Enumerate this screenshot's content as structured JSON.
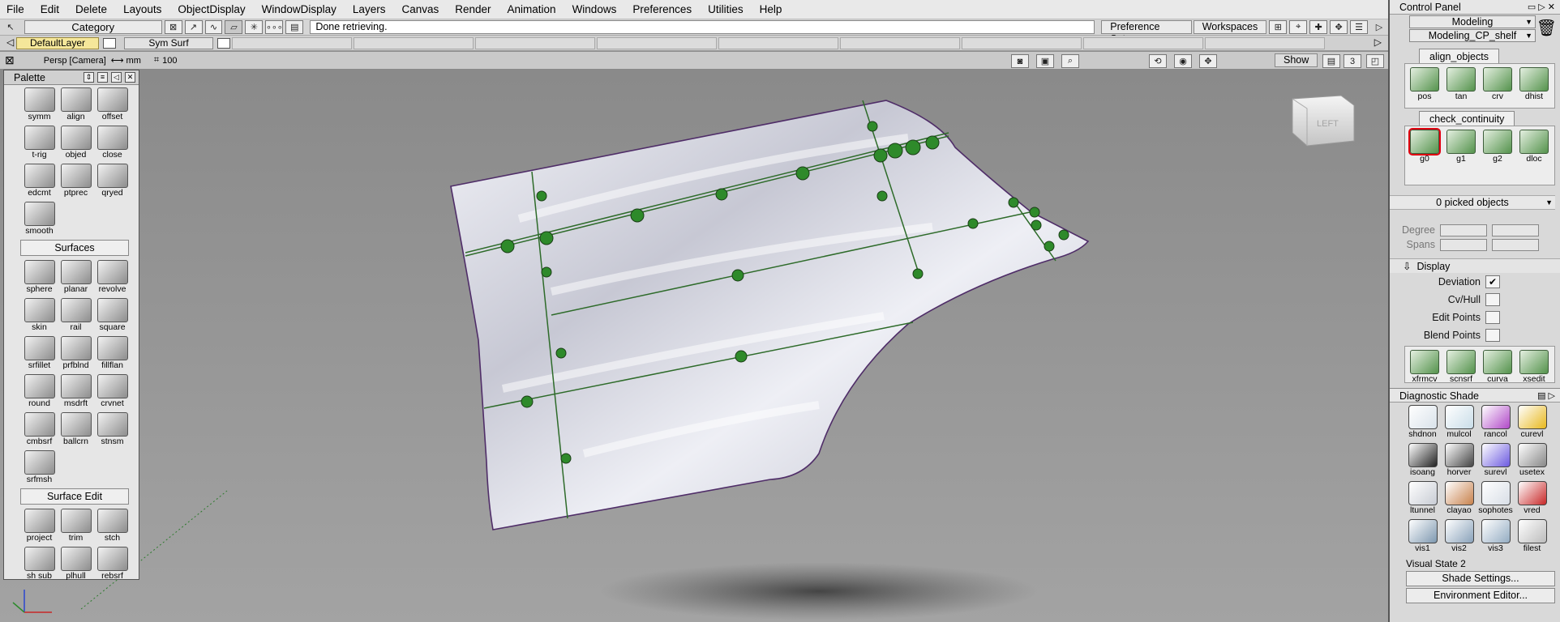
{
  "menu": [
    "File",
    "Edit",
    "Delete",
    "Layouts",
    "ObjectDisplay",
    "WindowDisplay",
    "Layers",
    "Canvas",
    "Render",
    "Animation",
    "Windows",
    "Preferences",
    "Utilities",
    "Help"
  ],
  "toolbar": {
    "category_label": "Category",
    "status_text": "Done retrieving.",
    "preference_sets": "Preference Sets",
    "workspaces": "Workspaces"
  },
  "layers": {
    "default": "DefaultLayer",
    "sym": "Sym Surf"
  },
  "viewbar": {
    "camera": "Persp [Camera]",
    "units": "mm",
    "grid": "100",
    "show_button": "Show",
    "count": "3"
  },
  "viewcube": {
    "face": "LEFT"
  },
  "palette": {
    "title": "Palette",
    "group1": [
      {
        "label": "symm"
      },
      {
        "label": "align"
      },
      {
        "label": "offset"
      },
      {
        "label": "t-rig"
      },
      {
        "label": "objed"
      },
      {
        "label": "close"
      },
      {
        "label": "edcmt"
      },
      {
        "label": "ptprec"
      },
      {
        "label": "qryed"
      },
      {
        "label": "smooth"
      }
    ],
    "surfaces_title": "Surfaces",
    "surfaces": [
      {
        "label": "sphere"
      },
      {
        "label": "planar"
      },
      {
        "label": "revolve"
      },
      {
        "label": "skin"
      },
      {
        "label": "rail"
      },
      {
        "label": "square"
      },
      {
        "label": "srfillet"
      },
      {
        "label": "prfblnd"
      },
      {
        "label": "fillflan"
      },
      {
        "label": "round"
      },
      {
        "label": "msdrft"
      },
      {
        "label": "crvnet"
      },
      {
        "label": "cmbsrf"
      },
      {
        "label": "ballcrn"
      },
      {
        "label": "stnsm"
      },
      {
        "label": "srfmsh"
      }
    ],
    "surface_edit_title": "Surface Edit",
    "surface_edit": [
      {
        "label": "project"
      },
      {
        "label": "trim"
      },
      {
        "label": "stch"
      },
      {
        "label": "sh sub"
      },
      {
        "label": "plhull"
      },
      {
        "label": "rebsrf"
      }
    ]
  },
  "cpanel": {
    "title": "Control Panel",
    "mode": "Modeling",
    "shelf": "Modeling_CP_shelf",
    "tab1": "align_objects",
    "align_items": [
      {
        "label": "pos"
      },
      {
        "label": "tan"
      },
      {
        "label": "crv"
      },
      {
        "label": "dhist"
      }
    ],
    "tab2": "check_continuity",
    "continuity_items": [
      {
        "label": "g0"
      },
      {
        "label": "g1"
      },
      {
        "label": "g2"
      },
      {
        "label": "dloc"
      }
    ],
    "picked": "0 picked objects",
    "degree_label": "Degree",
    "spans_label": "Spans",
    "display_label": "Display",
    "options": [
      {
        "label": "Deviation",
        "checked": "✔"
      },
      {
        "label": "Cv/Hull",
        "checked": ""
      },
      {
        "label": "Edit Points",
        "checked": ""
      },
      {
        "label": "Blend Points",
        "checked": ""
      }
    ],
    "tools": [
      {
        "label": "xfrmcv"
      },
      {
        "label": "scnsrf"
      },
      {
        "label": "curva"
      },
      {
        "label": "xsedit"
      }
    ],
    "diag_title": "Diagnostic Shade",
    "diag_items": [
      {
        "label": "shdnon",
        "color": "#d9e2ea"
      },
      {
        "label": "mulcol",
        "color": "#c9dde8"
      },
      {
        "label": "rancol",
        "color": "#b048c8"
      },
      {
        "label": "curevl",
        "color": "#e8b81e"
      },
      {
        "label": "isoang",
        "color": "#222222"
      },
      {
        "label": "horver",
        "color": "#444444"
      },
      {
        "label": "surevl",
        "color": "#6c5ae0"
      },
      {
        "label": "usetex",
        "color": "#888888"
      },
      {
        "label": "ltunnel",
        "color": "#c8ccd4"
      },
      {
        "label": "clayao",
        "color": "#c8824c"
      },
      {
        "label": "sophotes",
        "color": "#d8dee6"
      },
      {
        "label": "vred",
        "color": "#c82828"
      },
      {
        "label": "vis1",
        "color": "#7e98b0"
      },
      {
        "label": "vis2",
        "color": "#8aa2ba"
      },
      {
        "label": "vis3",
        "color": "#94acc2"
      },
      {
        "label": "filest",
        "color": "#bcbcbc"
      }
    ],
    "visual_state": "Visual State 2",
    "shade_settings": "Shade Settings...",
    "env_editor": "Environment Editor..."
  }
}
